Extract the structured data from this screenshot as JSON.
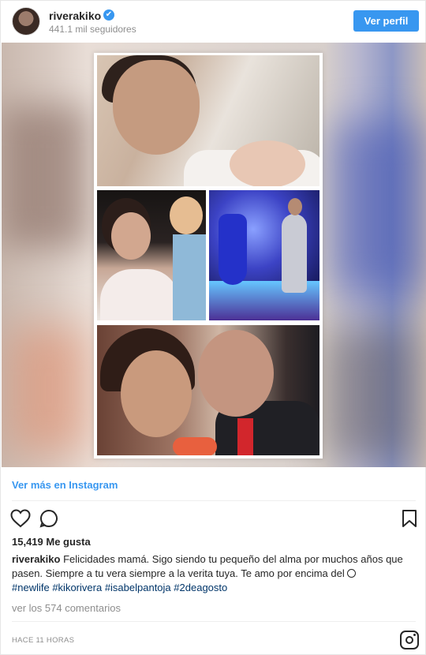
{
  "header": {
    "username": "riverakiko",
    "verified_mark": "✔",
    "followers": "441.1 mil seguidores",
    "profile_button": "Ver perfil"
  },
  "post": {
    "view_more": "Ver más en Instagram",
    "likes": "15,419 Me gusta",
    "caption": {
      "user": "riverakiko",
      "text": "Felicidades mamá. Sigo siendo tu pequeño del alma por muchos años que pasen. Siempre a tu vera siempre a la verita tuya. Te amo por encima del",
      "hashtags": [
        "#newlife",
        "#kikorivera",
        "#isabelpantoja",
        "#2deagosto"
      ]
    },
    "comments_link": "ver los 574 comentarios",
    "timestamp": "HACE 11 HORAS"
  },
  "colors": {
    "accent": "#3897f0",
    "hashtag": "#003569",
    "muted": "#8e8e8e"
  },
  "icons": [
    "heart-icon",
    "comment-icon",
    "bookmark-icon",
    "instagram-logo-icon",
    "verified-badge-icon",
    "globe-emoji-icon"
  ]
}
